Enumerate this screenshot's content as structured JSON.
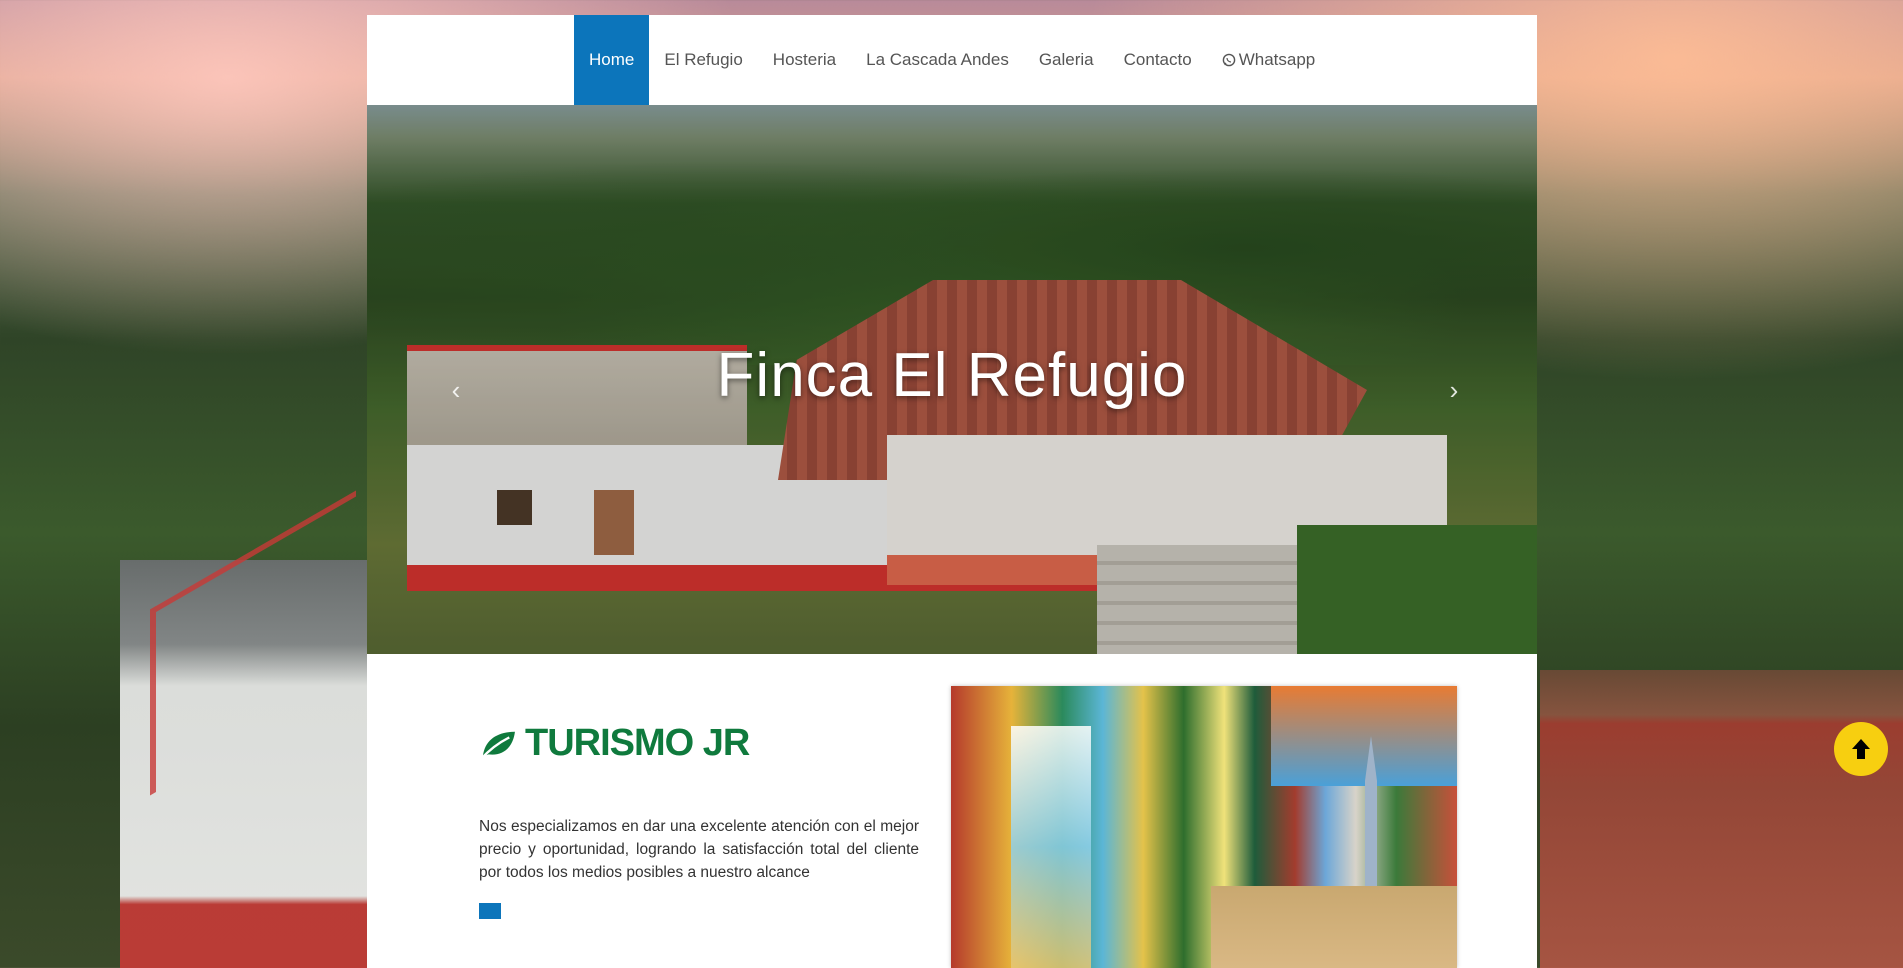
{
  "nav": {
    "items": [
      {
        "label": "Home",
        "active": true
      },
      {
        "label": "El Refugio",
        "active": false
      },
      {
        "label": "Hosteria",
        "active": false
      },
      {
        "label": "La Cascada Andes",
        "active": false
      },
      {
        "label": "Galeria",
        "active": false
      },
      {
        "label": "Contacto",
        "active": false
      },
      {
        "label": "Whatsapp",
        "active": false,
        "icon": "whatsapp-icon"
      }
    ],
    "active_color": "#0c75bb"
  },
  "hero": {
    "title": "Finca El Refugio",
    "prev_arrow": "‹",
    "next_arrow": "›"
  },
  "intro": {
    "brand": "TURISMO JR",
    "brand_icon": "leaf-icon",
    "brand_color": "#0f7a3d",
    "description": "Nos especializamos en dar una excelente atención con el mejor precio y oportunidad, logrando la satisfacción total del cliente por todos los medios posibles a nuestro alcance"
  },
  "back_to_top": {
    "icon": "arrow-up-icon",
    "color": "#f7cf10"
  }
}
